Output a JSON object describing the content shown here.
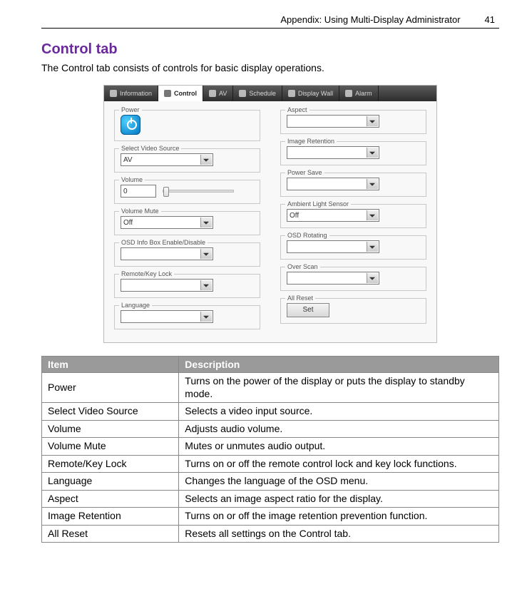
{
  "header": {
    "running": "Appendix: Using Multi-Display Administrator",
    "page": "41"
  },
  "title": "Control tab",
  "intro": "The Control tab consists of controls for basic display operations.",
  "tabs": [
    "Information",
    "Control",
    "AV",
    "Schedule",
    "Display Wall",
    "Alarm"
  ],
  "activeTab": "Control",
  "groupsLeft": [
    {
      "label": "Power",
      "type": "power"
    },
    {
      "label": "Select Video Source",
      "type": "dropdown",
      "value": "AV"
    },
    {
      "label": "Volume",
      "type": "volume",
      "value": "0"
    },
    {
      "label": "Volume Mute",
      "type": "dropdown",
      "value": "Off"
    },
    {
      "label": "OSD Info Box Enable/Disable",
      "type": "dropdown",
      "value": ""
    },
    {
      "label": "Remote/Key Lock",
      "type": "dropdown",
      "value": ""
    },
    {
      "label": "Language",
      "type": "dropdown",
      "value": ""
    }
  ],
  "groupsRight": [
    {
      "label": "Aspect",
      "type": "dropdown",
      "value": ""
    },
    {
      "label": "Image Retention",
      "type": "dropdown",
      "value": ""
    },
    {
      "label": "Power Save",
      "type": "dropdown",
      "value": ""
    },
    {
      "label": "Ambient Light Sensor",
      "type": "dropdown",
      "value": "Off"
    },
    {
      "label": "OSD Rotating",
      "type": "dropdown",
      "value": ""
    },
    {
      "label": "Over Scan",
      "type": "dropdown",
      "value": ""
    },
    {
      "label": "All Reset",
      "type": "button",
      "buttonLabel": "Set"
    }
  ],
  "tableHead": {
    "item": "Item",
    "desc": "Description"
  },
  "rows": [
    {
      "item": "Power",
      "desc": "Turns on the power of the display or puts the display to standby mode."
    },
    {
      "item": "Select Video Source",
      "desc": "Selects a video input source."
    },
    {
      "item": "Volume",
      "desc": "Adjusts audio volume."
    },
    {
      "item": "Volume Mute",
      "desc": "Mutes or unmutes audio output."
    },
    {
      "item": "Remote/Key Lock",
      "desc": "Turns on or off the remote control lock and key lock functions."
    },
    {
      "item": "Language",
      "desc": "Changes the language of the OSD menu."
    },
    {
      "item": "Aspect",
      "desc": "Selects an image aspect ratio for the display."
    },
    {
      "item": "Image Retention",
      "desc": "Turns on or off the image retention prevention function."
    },
    {
      "item": "All Reset",
      "desc": "Resets all settings on the Control tab."
    }
  ]
}
